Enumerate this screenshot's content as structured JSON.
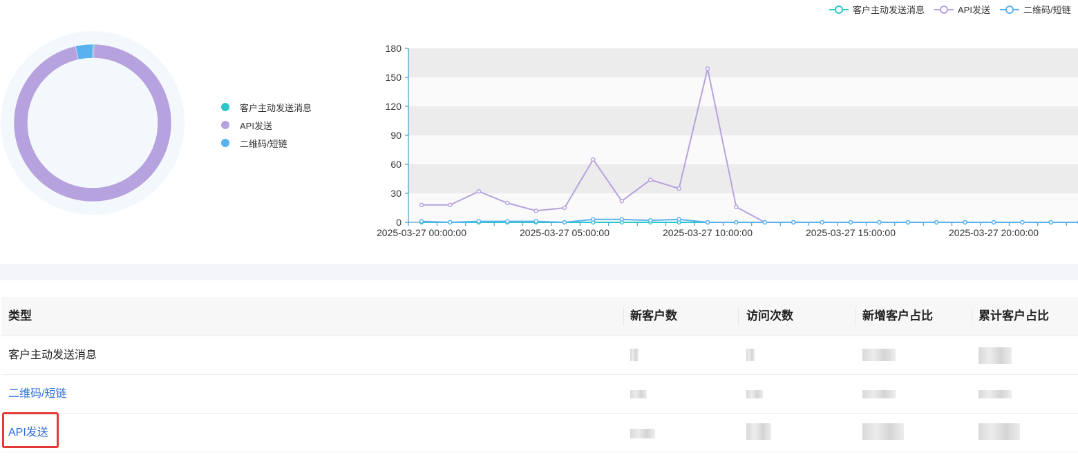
{
  "colors": {
    "customer_active": "#2ec7c9",
    "api_send": "#b6a2de",
    "qr_short": "#5ab1ef"
  },
  "legend": {
    "items": [
      {
        "label": "客户主动发送消息",
        "color": "#2ec7c9"
      },
      {
        "label": "API发送",
        "color": "#b6a2de"
      },
      {
        "label": "二维码/短链",
        "color": "#5ab1ef"
      }
    ]
  },
  "chart_data": [
    {
      "type": "pie",
      "categories": [
        "客户主动发送消息",
        "API发送",
        "二维码/短链"
      ],
      "values": [
        0.3,
        96.2,
        3.5
      ],
      "title": "",
      "legend_position": "right"
    },
    {
      "type": "line",
      "title": "",
      "xlabel": "",
      "ylabel": "",
      "ylim": [
        0,
        180
      ],
      "yticks": [
        0,
        30,
        60,
        90,
        120,
        150,
        180
      ],
      "x": [
        "2025-03-27 00:00:00",
        "2025-03-27 01:00:00",
        "2025-03-27 02:00:00",
        "2025-03-27 03:00:00",
        "2025-03-27 04:00:00",
        "2025-03-27 05:00:00",
        "2025-03-27 06:00:00",
        "2025-03-27 07:00:00",
        "2025-03-27 08:00:00",
        "2025-03-27 09:00:00",
        "2025-03-27 10:00:00",
        "2025-03-27 11:00:00",
        "2025-03-27 12:00:00",
        "2025-03-27 13:00:00",
        "2025-03-27 14:00:00",
        "2025-03-27 15:00:00",
        "2025-03-27 16:00:00",
        "2025-03-27 17:00:00",
        "2025-03-27 18:00:00",
        "2025-03-27 19:00:00",
        "2025-03-27 20:00:00",
        "2025-03-27 21:00:00",
        "2025-03-27 22:00:00",
        "2025-03-27 23:00:00"
      ],
      "xtick_labels": [
        "2025-03-27 00:00:00",
        "2025-03-27 05:00:00",
        "2025-03-27 10:00:00",
        "2025-03-27 15:00:00",
        "2025-03-27 20:00:00"
      ],
      "grid": true,
      "legend_position": "top-right",
      "series": [
        {
          "name": "客户主动发送消息",
          "color": "#2ec7c9",
          "values": [
            0,
            0,
            0,
            0,
            0,
            0,
            0,
            0,
            0,
            0,
            0,
            0,
            0,
            0,
            0,
            0,
            0,
            0,
            0,
            0,
            0,
            0,
            0,
            0
          ]
        },
        {
          "name": "API发送",
          "color": "#b6a2de",
          "values": [
            18,
            18,
            32,
            20,
            12,
            15,
            65,
            22,
            44,
            35,
            159,
            16,
            0,
            0,
            0,
            0,
            0,
            0,
            0,
            0,
            0,
            0,
            0,
            0
          ]
        },
        {
          "name": "二维码/短链",
          "color": "#5ab1ef",
          "values": [
            1,
            0,
            1,
            1,
            1,
            0,
            3,
            3,
            2,
            3,
            0,
            0,
            0,
            0,
            0,
            0,
            0,
            0,
            0,
            0,
            0,
            0,
            0,
            0
          ]
        }
      ]
    }
  ],
  "table": {
    "headers": [
      "类型",
      "新客户数",
      "访问次数",
      "新增客户占比",
      "累计客户占比"
    ],
    "rows": [
      {
        "type": "客户主动发送消息",
        "is_link": false
      },
      {
        "type": "二维码/短链",
        "is_link": true
      },
      {
        "type": "API发送",
        "is_link": true
      }
    ]
  }
}
